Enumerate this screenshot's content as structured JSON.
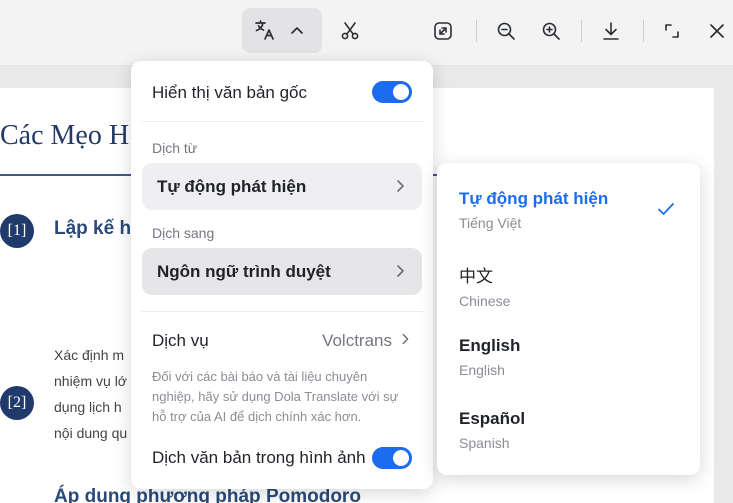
{
  "toolbar": {
    "icons": [
      "translate-icon",
      "chevron-up-icon",
      "scissors-icon",
      "open-external-icon",
      "zoom-out-icon",
      "zoom-in-icon",
      "download-icon",
      "expand-icon",
      "close-icon"
    ]
  },
  "document": {
    "title": "Các Mẹo H",
    "sections": [
      {
        "number": "[1]",
        "heading": "Lập kế h",
        "lines": [
          "Xác định m",
          "nhiệm vụ lớ",
          "dụng lịch h",
          "nội dung qu"
        ]
      },
      {
        "number": "[2]",
        "heading": "Áp dụng phương pháp Pomodoro",
        "lines": []
      }
    ]
  },
  "panel": {
    "show_original_label": "Hiển thị văn bản gốc",
    "show_original_on": true,
    "from_caption": "Dịch từ",
    "from_value": "Tự động phát hiện",
    "to_caption": "Dịch sang",
    "to_value": "Ngôn ngữ trình duyệt",
    "service_label": "Dịch vụ",
    "service_value": "Volctrans",
    "service_note": "Đối với các bài báo và tài liệu chuyên nghiệp, hãy sử dụng Dola Translate với sự hỗ trợ của AI để dịch chính xác hơn.",
    "image_translate_label": "Dịch văn bản trong hình ảnh",
    "image_translate_on": true
  },
  "submenu": {
    "options": [
      {
        "name": "Tự động phát hiện",
        "sub": "Tiếng Việt",
        "selected": true
      },
      {
        "name": "中文",
        "sub": "Chinese",
        "selected": false
      },
      {
        "name": "English",
        "sub": "English",
        "selected": false
      },
      {
        "name": "Español",
        "sub": "Spanish",
        "selected": false
      }
    ]
  },
  "colors": {
    "accent": "#1d6cf0",
    "heading": "#2a4a7a",
    "badge": "#1f3a6b"
  }
}
